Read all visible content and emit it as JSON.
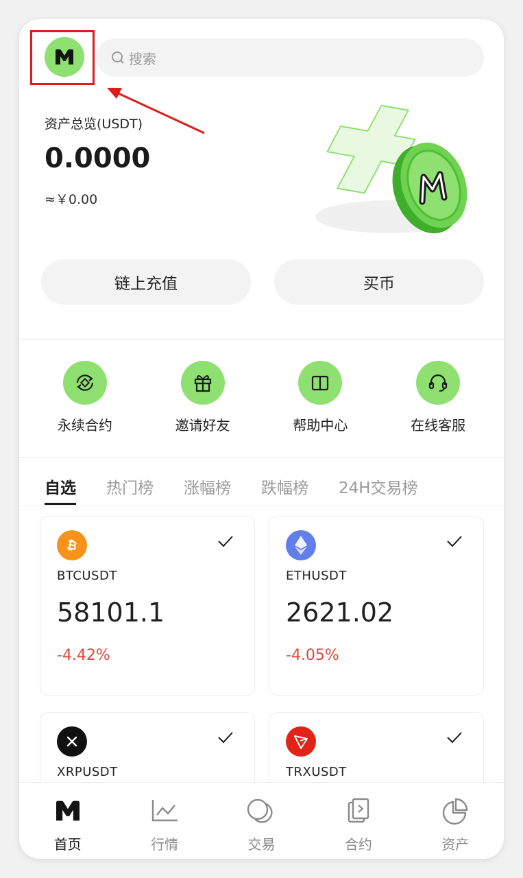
{
  "header": {
    "search_placeholder": "搜索"
  },
  "asset": {
    "title": "资产总览(USDT)",
    "value": "0.0000",
    "cny": "≈￥0.00"
  },
  "actions": {
    "deposit": "链上充值",
    "buy": "买币"
  },
  "quick": [
    {
      "label": "永续合约",
      "icon": "perpetual-icon"
    },
    {
      "label": "邀请好友",
      "icon": "gift-icon"
    },
    {
      "label": "帮助中心",
      "icon": "book-icon"
    },
    {
      "label": "在线客服",
      "icon": "headset-icon"
    }
  ],
  "tabs": [
    "自选",
    "热门榜",
    "涨幅榜",
    "跌幅榜",
    "24H交易榜"
  ],
  "markets": [
    {
      "symbol": "BTCUSDT",
      "price": "58101.1",
      "change": "-4.42%",
      "coin_color": "#f7931a"
    },
    {
      "symbol": "ETHUSDT",
      "price": "2621.02",
      "change": "-4.05%",
      "coin_color": "#627eea"
    },
    {
      "symbol": "XRPUSDT",
      "price": "",
      "change": "",
      "coin_color": "#111111"
    },
    {
      "symbol": "TRXUSDT",
      "price": "",
      "change": "",
      "coin_color": "#e2231a"
    }
  ],
  "nav": [
    "首页",
    "行情",
    "交易",
    "合约",
    "资产"
  ],
  "colors": {
    "accent": "#8ee070",
    "negative": "#e0463c",
    "highlight": "#e01b1b"
  }
}
